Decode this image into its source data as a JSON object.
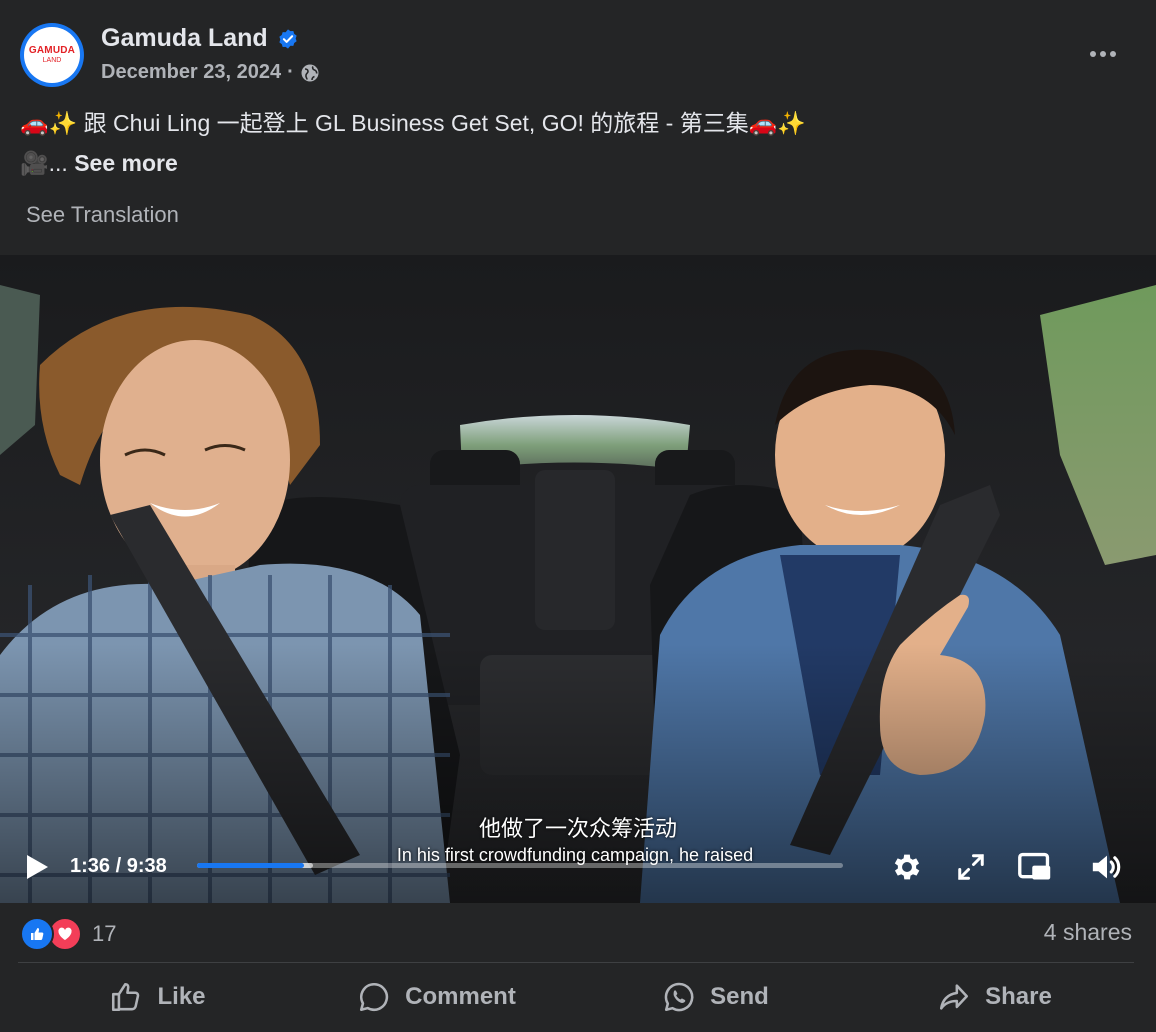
{
  "page": {
    "name": "Gamuda Land",
    "date": "December 23, 2024",
    "separator": "·",
    "avatar_logo_top": "GAMUDA",
    "avatar_logo_bottom": "LAND",
    "more_icon": "more-horizontal-icon",
    "verified_icon": "verified-badge-icon",
    "audience_icon": "globe-icon"
  },
  "post": {
    "text_line1": "🚗✨ 跟 Chui Ling 一起登上 GL Business Get Set, GO! 的旅程 - 第三集🚗✨",
    "text_line2_prefix": "🎥... ",
    "see_more": "See more",
    "see_translation": "See Translation"
  },
  "video": {
    "subtitle_zh": "他做了一次众筹活动",
    "subtitle_en": "In his first crowdfunding campaign, he raised",
    "current_time": "1:36",
    "duration": "9:38",
    "time_display": "1:36 / 9:38",
    "progress": 0.166,
    "buffered": 0.18,
    "icons": [
      "play-icon",
      "settings-gear-icon",
      "fullscreen-icon",
      "picture-in-picture-icon",
      "volume-icon"
    ]
  },
  "engagement": {
    "reaction_count": "17",
    "shares": "4 shares",
    "reaction_icons": [
      "like-reaction-icon",
      "love-reaction-icon"
    ]
  },
  "actions": {
    "like": "Like",
    "comment": "Comment",
    "send": "Send",
    "share": "Share"
  },
  "colors": {
    "background": "#242526",
    "accent": "#1877f2",
    "love": "#f33e58",
    "text_primary": "#e4e6eb",
    "text_secondary": "#b0b3b8"
  }
}
